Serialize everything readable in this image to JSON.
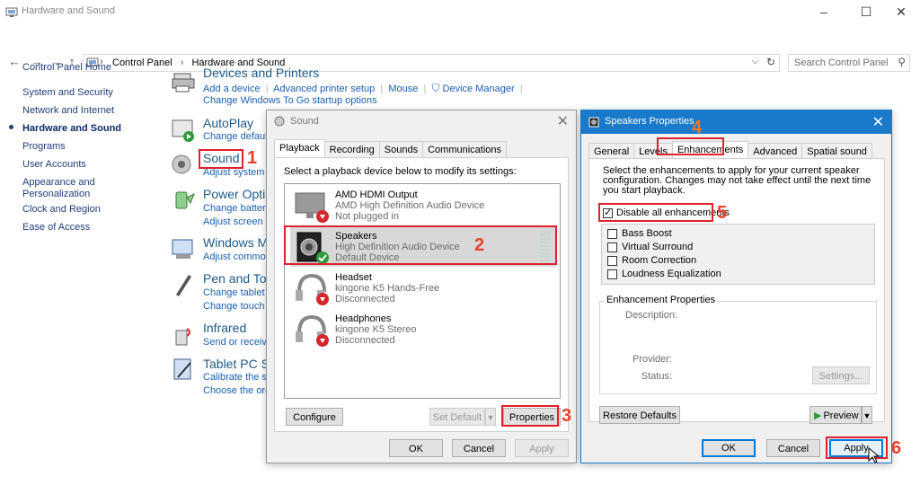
{
  "window": {
    "title": "Hardware and Sound"
  },
  "address": {
    "path": [
      "Control Panel",
      "Hardware and Sound"
    ],
    "search_placeholder": "Search Control Panel"
  },
  "left_nav": [
    {
      "label": "Control Panel Home"
    },
    {
      "label": "System and Security"
    },
    {
      "label": "Network and Internet"
    },
    {
      "label": "Hardware and Sound",
      "current": true
    },
    {
      "label": "Programs"
    },
    {
      "label": "User Accounts"
    },
    {
      "label": "Appearance and\nPersonalization"
    },
    {
      "label": "Clock and Region"
    },
    {
      "label": "Ease of Access"
    }
  ],
  "categories": {
    "devices": {
      "title": "Devices and Printers",
      "links": [
        "Add a device",
        "Advanced printer setup",
        "Mouse",
        "Device Manager",
        "Change Windows To Go startup options"
      ]
    },
    "autoplay": {
      "title": "AutoPlay",
      "links": [
        "Change default"
      ]
    },
    "sound": {
      "title": "Sound",
      "links": [
        "Adjust system"
      ]
    },
    "power": {
      "title": "Power Optic",
      "links": [
        "Change battery",
        "Adjust screen b"
      ]
    },
    "windows": {
      "title": "Windows M",
      "links": [
        "Adjust commo"
      ]
    },
    "pen": {
      "title": "Pen and Tou",
      "links": [
        "Change tablet p",
        "Change touch i"
      ]
    },
    "infrared": {
      "title": "Infrared",
      "links": [
        "Send or receive"
      ]
    },
    "tablet": {
      "title": "Tablet PC Se",
      "links": [
        "Calibrate the sc",
        "Choose the ord"
      ]
    }
  },
  "sound_dialog": {
    "title": "Sound",
    "tabs": [
      "Playback",
      "Recording",
      "Sounds",
      "Communications"
    ],
    "instruction": "Select a playback device below to modify its settings:",
    "devices": [
      {
        "name": "AMD HDMI Output",
        "desc": "AMD High Definition Audio Device",
        "status": "Not plugged in"
      },
      {
        "name": "Speakers",
        "desc": "High Definition Audio Device",
        "status": "Default Device"
      },
      {
        "name": "Headset",
        "desc": "kingone K5 Hands-Free",
        "status": "Disconnected"
      },
      {
        "name": "Headphones",
        "desc": "kingone K5 Stereo",
        "status": "Disconnected"
      }
    ],
    "buttons": {
      "configure": "Configure",
      "set_default": "Set Default",
      "properties": "Properties",
      "ok": "OK",
      "cancel": "Cancel",
      "apply": "Apply"
    }
  },
  "speakers_dialog": {
    "title": "Speakers Properties",
    "tabs": [
      "General",
      "Levels",
      "Enhancements",
      "Advanced",
      "Spatial sound"
    ],
    "intro": "Select the enhancements to apply for your current speaker configuration. Changes may not take effect until the next time you start playback.",
    "disable_all": "Disable all enhancements",
    "enhancements": [
      "Bass Boost",
      "Virtual Surround",
      "Room Correction",
      "Loudness Equalization"
    ],
    "props_group": "Enhancement Properties",
    "labels": {
      "description": "Description:",
      "provider": "Provider:",
      "status": "Status:"
    },
    "buttons": {
      "settings": "Settings...",
      "restore": "Restore Defaults",
      "preview": "Preview",
      "ok": "OK",
      "cancel": "Cancel",
      "apply": "Apply"
    }
  },
  "steps": [
    "1",
    "2",
    "3",
    "4",
    "5",
    "6"
  ]
}
